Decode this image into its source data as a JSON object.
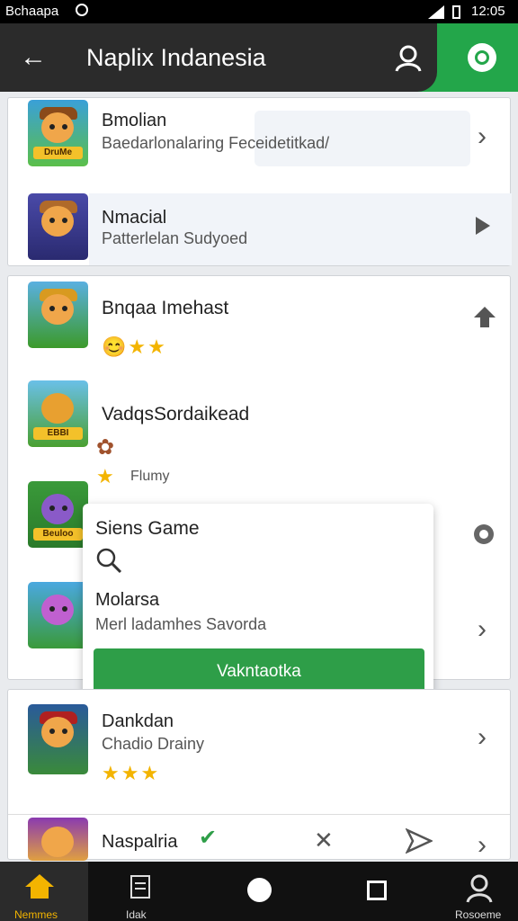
{
  "status_bar": {
    "carrier": "Bchaapa",
    "time": "12:05"
  },
  "app_bar": {
    "title": "Naplix Indanesia"
  },
  "card1": {
    "items": [
      {
        "name": "Bmolian",
        "subtitle": "Baedarlonalaring Feceidetitkad/",
        "thumb_label": "DruMe"
      },
      {
        "name": "Nmacial",
        "subtitle": "Patterlelan Sudyoed",
        "thumb_label": ""
      }
    ]
  },
  "card2": {
    "items": [
      {
        "name": "Bnqaa Imehast",
        "thumb_label": ""
      },
      {
        "name": "VadqsSordaikead",
        "thumb_label": "EBBI",
        "tag": "Flumy"
      },
      {
        "name": "",
        "thumb_label": "Beuloo"
      },
      {
        "name": "",
        "thumb_label": ""
      }
    ]
  },
  "popup": {
    "title": "Siens Game",
    "item_name": "Molarsa",
    "item_subtitle": "Merl ladamhes Savorda",
    "cta_label": "Vakntaotka"
  },
  "card3": {
    "items": [
      {
        "name": "Dankdan",
        "subtitle": "Chadio Drainy",
        "thumb_label": ""
      },
      {
        "name": "Naspalria",
        "thumb_label": ""
      }
    ]
  },
  "bottom_nav": {
    "home": "Nemmes",
    "docs": "Idak",
    "profile": "Rosoeme"
  },
  "colors": {
    "accent": "#23a64a",
    "appbar": "#2b2b2b",
    "star": "#f3b400"
  }
}
